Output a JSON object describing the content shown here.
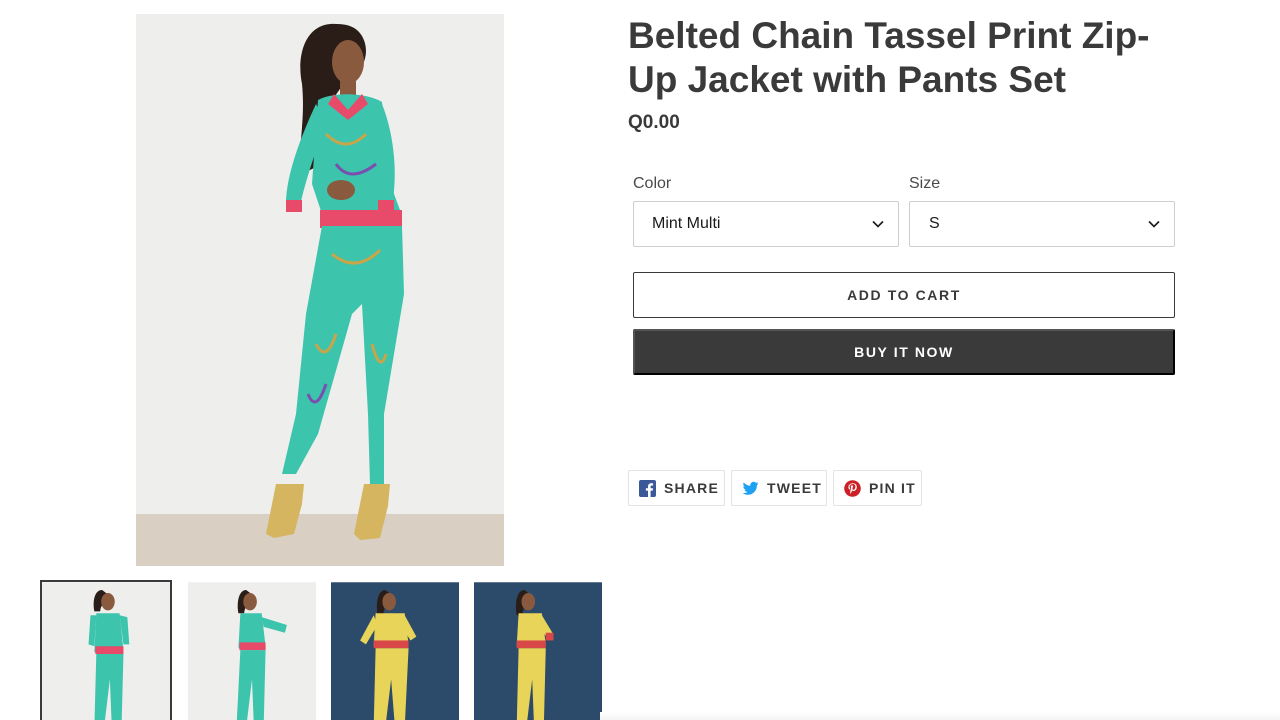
{
  "product": {
    "title": "Belted Chain Tassel Print Zip-Up Jacket with Pants Set",
    "price": "Q0.00"
  },
  "options": {
    "color": {
      "label": "Color",
      "value": "Mint Multi"
    },
    "size": {
      "label": "Size",
      "value": "S"
    }
  },
  "buttons": {
    "add_to_cart": "ADD TO CART",
    "buy_now": "BUY IT NOW"
  },
  "share": {
    "facebook": "SHARE",
    "twitter": "TWEET",
    "pinterest": "PIN IT"
  },
  "gallery": {
    "main": {
      "icon": "product-photo-mint-outfit"
    },
    "thumbnails": [
      {
        "variant": "mint",
        "background": "light",
        "selected": true
      },
      {
        "variant": "mint",
        "background": "light",
        "selected": false
      },
      {
        "variant": "yellow",
        "background": "navy",
        "selected": false
      },
      {
        "variant": "yellow",
        "background": "navy",
        "selected": false
      }
    ]
  },
  "colors": {
    "text": "#3a3a3a",
    "buy_button": "#3a3a3a",
    "facebook": "#3b5998",
    "twitter": "#1da1f2",
    "pinterest": "#cb2027",
    "mint_outfit": "#3cc4ad",
    "yellow_outfit": "#e9d45a",
    "navy_bg": "#2c4a69"
  }
}
